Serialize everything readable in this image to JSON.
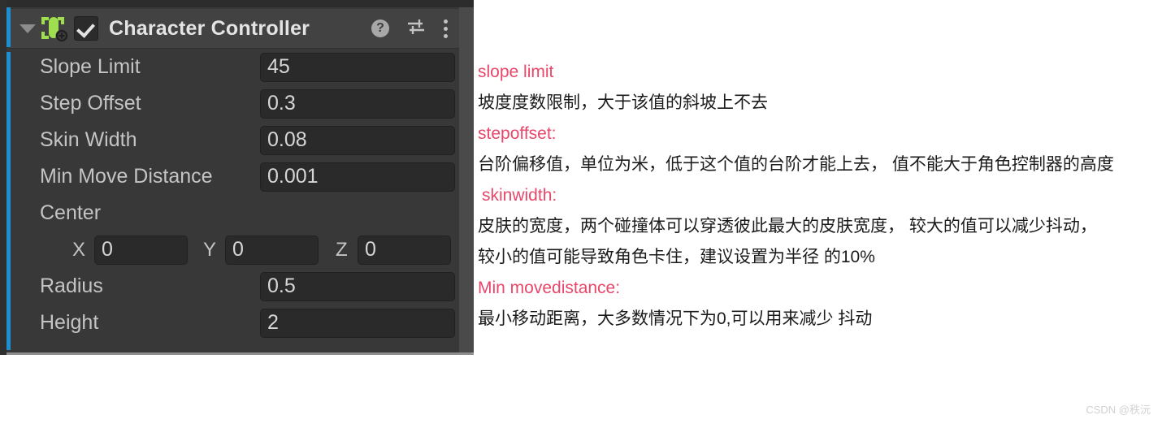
{
  "panel": {
    "title": "Character Controller",
    "enabled": true,
    "icons": {
      "foldout": "caret-down-icon",
      "component": "character-controller-icon",
      "checkbox": "enabled-checkbox",
      "help": "help-icon",
      "preset": "preset-sliders-icon",
      "menu": "kebab-menu-icon"
    },
    "help_glyph": "?",
    "accent_color": "#1d8fd1",
    "icon_color": "#9ede4f",
    "background_color": "#383838"
  },
  "properties": [
    {
      "label": "Slope Limit",
      "value": "45"
    },
    {
      "label": "Step Offset",
      "value": "0.3"
    },
    {
      "label": "Skin Width",
      "value": "0.08"
    },
    {
      "label": "Min Move Distance",
      "value": "0.001"
    }
  ],
  "center": {
    "label": "Center",
    "axes": [
      {
        "axis": "X",
        "value": "0"
      },
      {
        "axis": "Y",
        "value": "0"
      },
      {
        "axis": "Z",
        "value": "0"
      }
    ]
  },
  "properties_bottom": [
    {
      "label": "Radius",
      "value": "0.5"
    },
    {
      "label": "Height",
      "value": "2"
    }
  ],
  "annotations": {
    "heading_color": "#e8476a",
    "lines": [
      {
        "type": "head",
        "text": "slope limit"
      },
      {
        "type": "body",
        "text": "坡度度数限制，大于该值的斜坡上不去"
      },
      {
        "type": "head",
        "text": "stepoffset:"
      },
      {
        "type": "body",
        "text": "台阶偏移值，单位为米，低于这个值的台阶才能上去， 值不能大于角色控制器的高度"
      },
      {
        "type": "head",
        "text": " skinwidth:",
        "indent": true
      },
      {
        "type": "body",
        "text": "皮肤的宽度，两个碰撞体可以穿透彼此最大的皮肤宽度， 较大的值可以减少抖动，"
      },
      {
        "type": "body",
        "text": "较小的值可能导致角色卡住，建议设置为半径 的10%"
      },
      {
        "type": "head",
        "text": "Min movedistance:"
      },
      {
        "type": "body",
        "text": "最小移动距离，大多数情况下为0,可以用来减少 抖动"
      }
    ]
  },
  "watermark": "CSDN @秩沅"
}
